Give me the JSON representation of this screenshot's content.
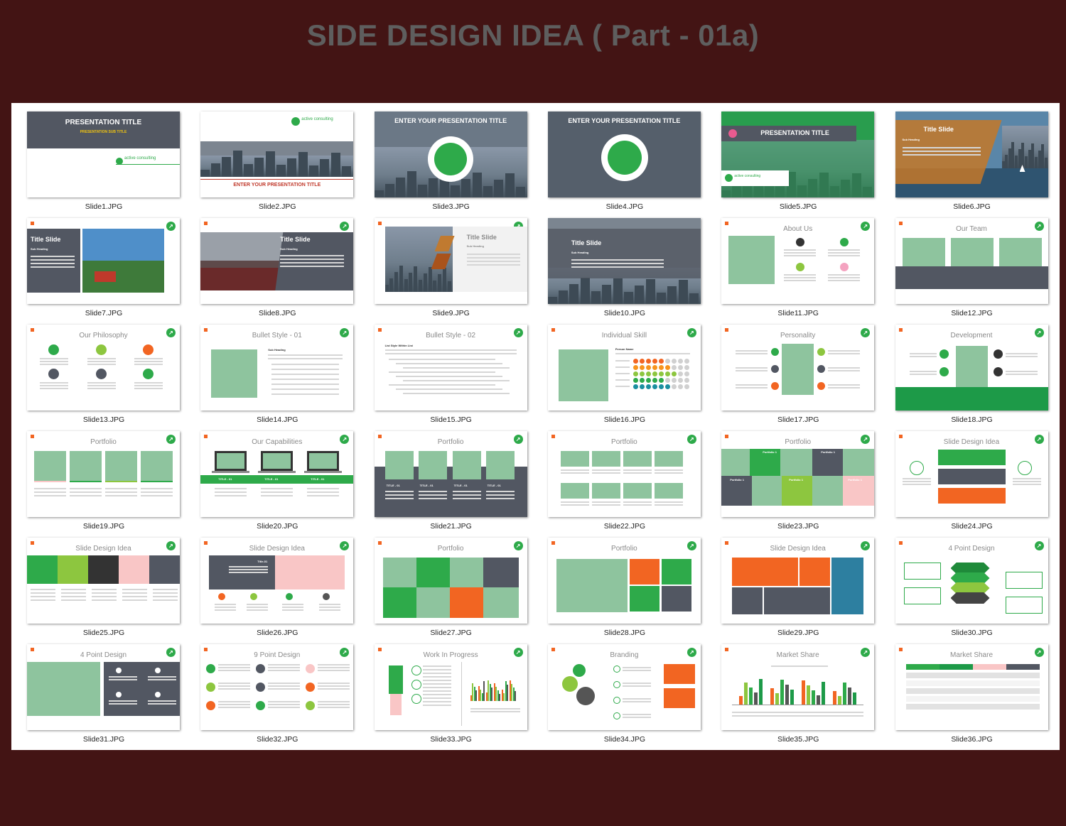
{
  "header": {
    "title": "SIDE DESIGN IDEA ( Part - 01a)"
  },
  "colors": {
    "background": "#431414",
    "panel": "#ffffff",
    "green": "#2eaa4a",
    "mint": "#8ec49e",
    "slate": "#525762",
    "orange": "#f26522",
    "pink": "#f9c6c6"
  },
  "slides": [
    {
      "caption": "Slide1.JPG",
      "title": "PRESENTATION TITLE",
      "subtitle": "PRESENTATION SUB TITLE",
      "logo": "active consulting"
    },
    {
      "caption": "Slide2.JPG",
      "title": "ENTER YOUR PRESENTATION TITLE",
      "logo": "active consulting"
    },
    {
      "caption": "Slide3.JPG",
      "title": "ENTER YOUR PRESENTATION TITLE"
    },
    {
      "caption": "Slide4.JPG",
      "title": "ENTER YOUR PRESENTATION TITLE"
    },
    {
      "caption": "Slide5.JPG",
      "title": "PRESENTATION TITLE",
      "logo": "active consulting"
    },
    {
      "caption": "Slide6.JPG",
      "title": "Title Slide",
      "subtitle": "Sub Heading"
    },
    {
      "caption": "Slide7.JPG",
      "title": "Title Slide",
      "subtitle": "Sub Heading"
    },
    {
      "caption": "Slide8.JPG",
      "title": "Title Slide",
      "subtitle": "Sub Heading"
    },
    {
      "caption": "Slide9.JPG",
      "title": "Title Slide",
      "subtitle": "Sub Heading"
    },
    {
      "caption": "Slide10.JPG",
      "title": "Title Slide",
      "subtitle": "Sub Heading"
    },
    {
      "caption": "Slide11.JPG",
      "title": "About Us"
    },
    {
      "caption": "Slide12.JPG",
      "title": "Our Team"
    },
    {
      "caption": "Slide13.JPG",
      "title": "Our Philosophy"
    },
    {
      "caption": "Slide14.JPG",
      "title": "Bullet Style - 01",
      "subtitle": "Sub Heading"
    },
    {
      "caption": "Slide15.JPG",
      "title": "Bullet Style - 02",
      "subtitle": "List Style Within List"
    },
    {
      "caption": "Slide16.JPG",
      "title": "Individual Skill",
      "subtitle": "Person Name"
    },
    {
      "caption": "Slide17.JPG",
      "title": "Personality"
    },
    {
      "caption": "Slide18.JPG",
      "title": "Development"
    },
    {
      "caption": "Slide19.JPG",
      "title": "Portfolio"
    },
    {
      "caption": "Slide20.JPG",
      "title": "Our Capabilities",
      "labels": [
        "TITLE - 01",
        "TITLE - 01",
        "TITLE - 01"
      ]
    },
    {
      "caption": "Slide21.JPG",
      "title": "Portfolio",
      "labels": [
        "TITLE - 01",
        "TITLE - 01",
        "TITLE - 01",
        "TITLE - 01"
      ]
    },
    {
      "caption": "Slide22.JPG",
      "title": "Portfolio"
    },
    {
      "caption": "Slide23.JPG",
      "title": "Portfolio",
      "labels": [
        "Portfolio 1",
        "Portfolio 1",
        "Portfolio 1",
        "Portfolio 1",
        "Portfolio 1"
      ]
    },
    {
      "caption": "Slide24.JPG",
      "title": "Slide Design Idea"
    },
    {
      "caption": "Slide25.JPG",
      "title": "Slide Design Idea"
    },
    {
      "caption": "Slide26.JPG",
      "title": "Slide Design Idea",
      "labels": [
        "Title-01"
      ]
    },
    {
      "caption": "Slide27.JPG",
      "title": "Portfolio"
    },
    {
      "caption": "Slide28.JPG",
      "title": "Portfolio"
    },
    {
      "caption": "Slide29.JPG",
      "title": "Slide Design Idea"
    },
    {
      "caption": "Slide30.JPG",
      "title": "4 Point Design"
    },
    {
      "caption": "Slide31.JPG",
      "title": "4 Point Design"
    },
    {
      "caption": "Slide32.JPG",
      "title": "9 Point Design"
    },
    {
      "caption": "Slide33.JPG",
      "title": "Work In Progress"
    },
    {
      "caption": "Slide34.JPG",
      "title": "Branding"
    },
    {
      "caption": "Slide35.JPG",
      "title": "Market Share"
    },
    {
      "caption": "Slide36.JPG",
      "title": "Market Share"
    }
  ]
}
